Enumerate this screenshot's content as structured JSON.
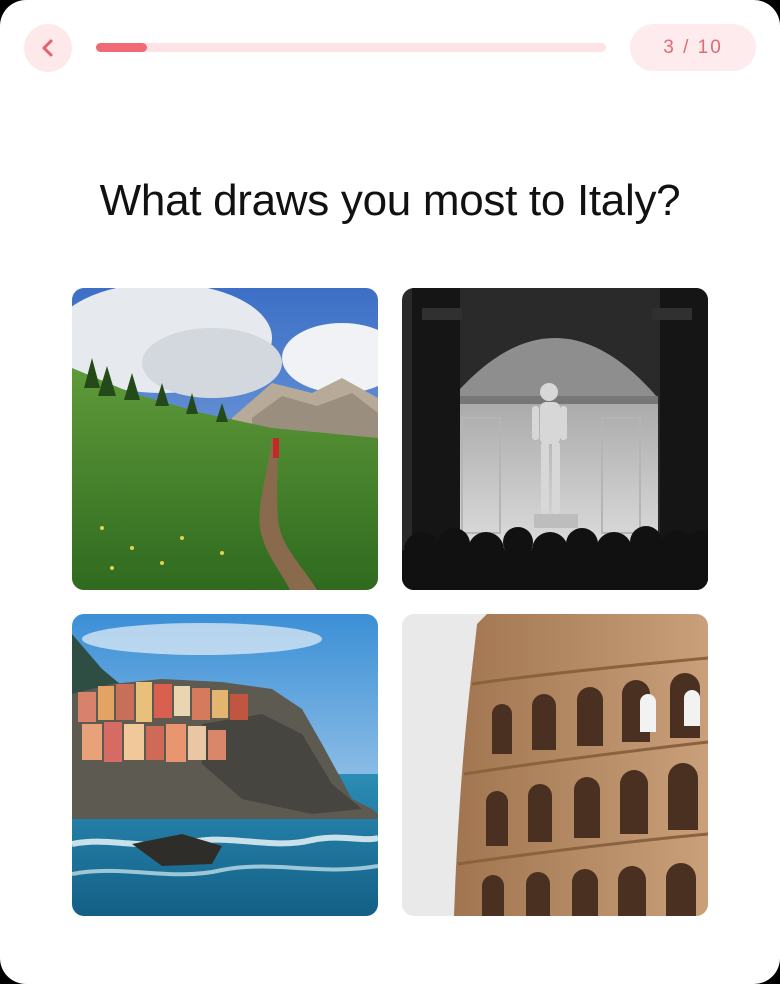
{
  "header": {
    "back_icon": "chevron-left-icon",
    "progress": {
      "current": 3,
      "total": 10,
      "fraction": 0.1
    },
    "step_label": "3 / 10"
  },
  "question": {
    "title": "What draws you most to Italy?"
  },
  "options": [
    {
      "image": "dolomites-mountain-trail-photo"
    },
    {
      "image": "statue-of-david-gallery-photo"
    },
    {
      "image": "cinque-terre-coastal-village-photo"
    },
    {
      "image": "colosseum-arches-photo"
    }
  ],
  "colors": {
    "accent": "#ef6a74",
    "accent_light": "#fde3e6",
    "text": "#111111"
  }
}
